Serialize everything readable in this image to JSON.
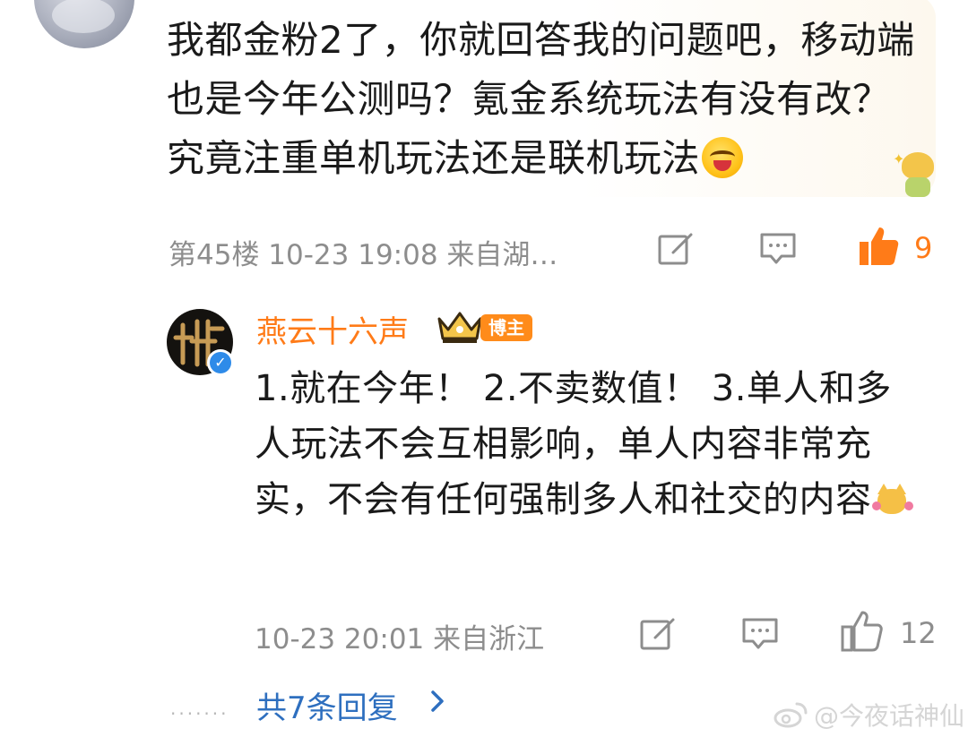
{
  "comment": {
    "text": "我都金粉2了，你就回答我的问题吧，移动端也是今年公测吗？氪金系统玩法有没有改？究竟注重单机玩法还是联机玩法",
    "floor_time_source": "第45楼  10-23 19:08  来自湖…",
    "like_count": "9",
    "emoji": "laughing-face-emoji",
    "sticker": "cartoon-character-sticker"
  },
  "reply": {
    "author": "燕云十六声",
    "author_badge": "博主",
    "verified": true,
    "text": "1.就在今年！ 2.不卖数值！ 3.单人和多人玩法不会互相影响，单人内容非常充实，不会有任何强制多人和社交的内容",
    "emoji": "dog-heart-emoji",
    "time_source": "10-23 20:01  来自浙江",
    "like_count": "12"
  },
  "more": {
    "dots": "·······",
    "label": "共7条回复"
  },
  "watermark": {
    "text": "@今夜话神仙"
  },
  "colors": {
    "accent": "#ff7b18",
    "link": "#2e6fbf",
    "meta": "#8d8d8d",
    "verify": "#2e8be9"
  }
}
